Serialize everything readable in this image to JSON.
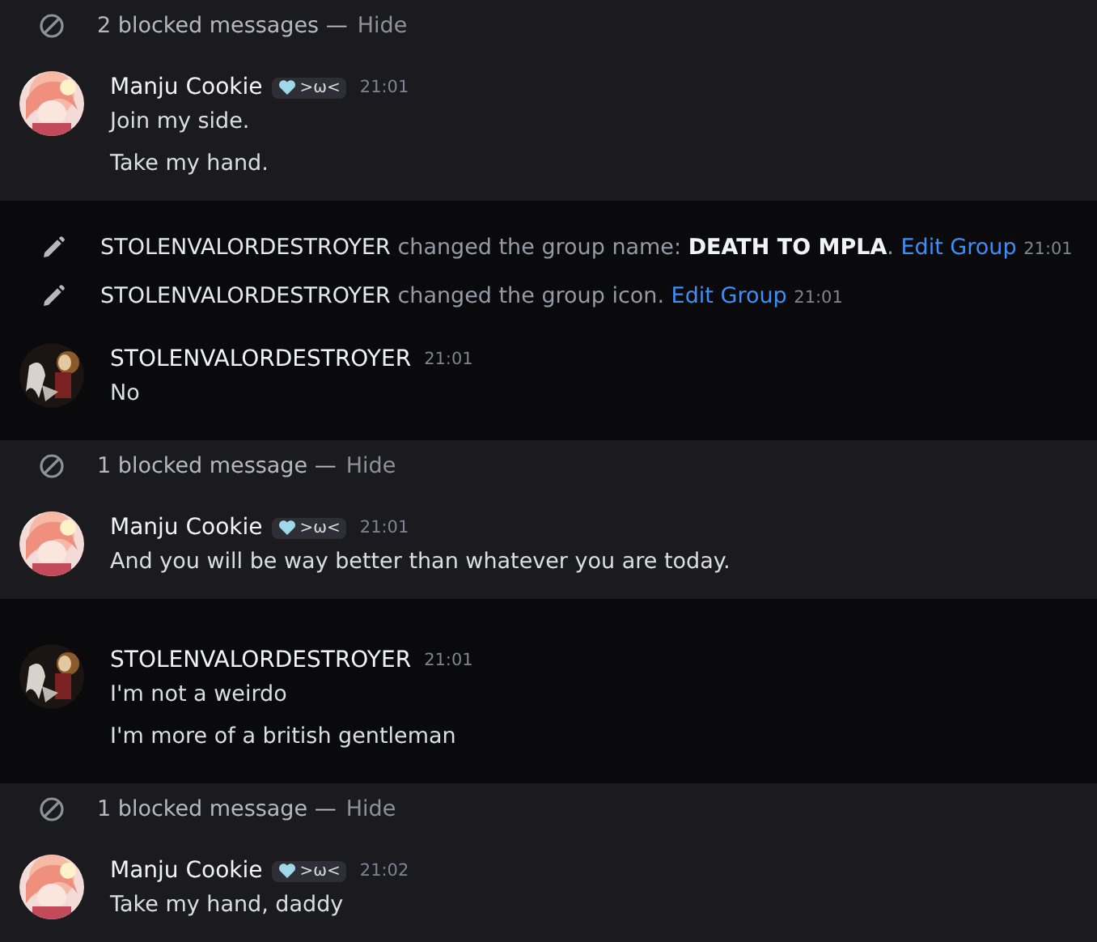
{
  "sections": [
    {
      "kind": "blocked",
      "notice": "2 blocked messages —",
      "action": "Hide",
      "items": [
        {
          "kind": "message",
          "author": "Manju Cookie",
          "badge": ">ω<",
          "time": "21:01",
          "lines": [
            "Join my side.",
            "Take my hand."
          ]
        }
      ]
    },
    {
      "kind": "normal",
      "items": [
        {
          "kind": "system",
          "actor": "STOLENVALORDESTROYER",
          "action": "changed the group name:",
          "value": "DEATH TO MPLA",
          "after": ".",
          "link": "Edit Group",
          "time": "21:01"
        },
        {
          "kind": "system",
          "actor": "STOLENVALORDESTROYER",
          "action": "changed the group icon.",
          "link": "Edit Group",
          "time": "21:01"
        },
        {
          "kind": "message",
          "author": "STOLENVALORDESTROYER",
          "time": "21:01",
          "lines": [
            "No"
          ]
        }
      ]
    },
    {
      "kind": "blocked",
      "notice": "1 blocked message —",
      "action": "Hide",
      "items": [
        {
          "kind": "message",
          "author": "Manju Cookie",
          "badge": ">ω<",
          "time": "21:01",
          "lines": [
            "And you will be way better than whatever you are today."
          ]
        }
      ]
    },
    {
      "kind": "normal",
      "items": [
        {
          "kind": "message",
          "author": "STOLENVALORDESTROYER",
          "time": "21:01",
          "lines": [
            "I'm not a weirdo",
            "I'm more of a british gentleman"
          ]
        }
      ]
    },
    {
      "kind": "blocked",
      "notice": "1 blocked message —",
      "action": "Hide",
      "items": [
        {
          "kind": "message",
          "author": "Manju Cookie",
          "badge": ">ω<",
          "time": "21:02",
          "lines": [
            "Take my hand, daddy"
          ]
        }
      ]
    }
  ]
}
